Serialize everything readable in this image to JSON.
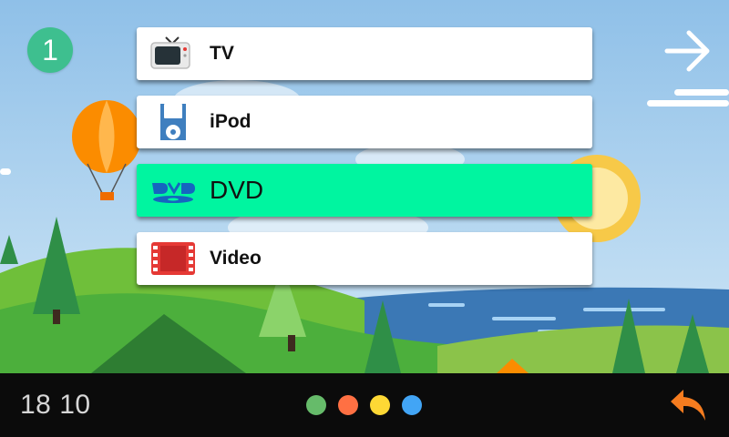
{
  "status": {
    "channel_badge": "1"
  },
  "menu": {
    "items": [
      {
        "label": "TV",
        "icon": "tv-icon",
        "active": false
      },
      {
        "label": "iPod",
        "icon": "ipod-icon",
        "active": false
      },
      {
        "label": "DVD",
        "icon": "dvd-logo-icon",
        "active": true
      },
      {
        "label": "Video",
        "icon": "video-film-icon",
        "active": false
      }
    ]
  },
  "nav": {
    "next_icon": "arrow-right-icon",
    "back_icon": "back-arrow-icon"
  },
  "bottom_bar": {
    "clock": "18 10",
    "page_dots": [
      {
        "color": "#66bb6a"
      },
      {
        "color": "#ff7043"
      },
      {
        "color": "#fdd835"
      },
      {
        "color": "#42a5f5"
      }
    ]
  },
  "colors": {
    "active_item": "#00f5a0",
    "badge": "#3ebf8f",
    "back_arrow": "#f57c1f"
  }
}
